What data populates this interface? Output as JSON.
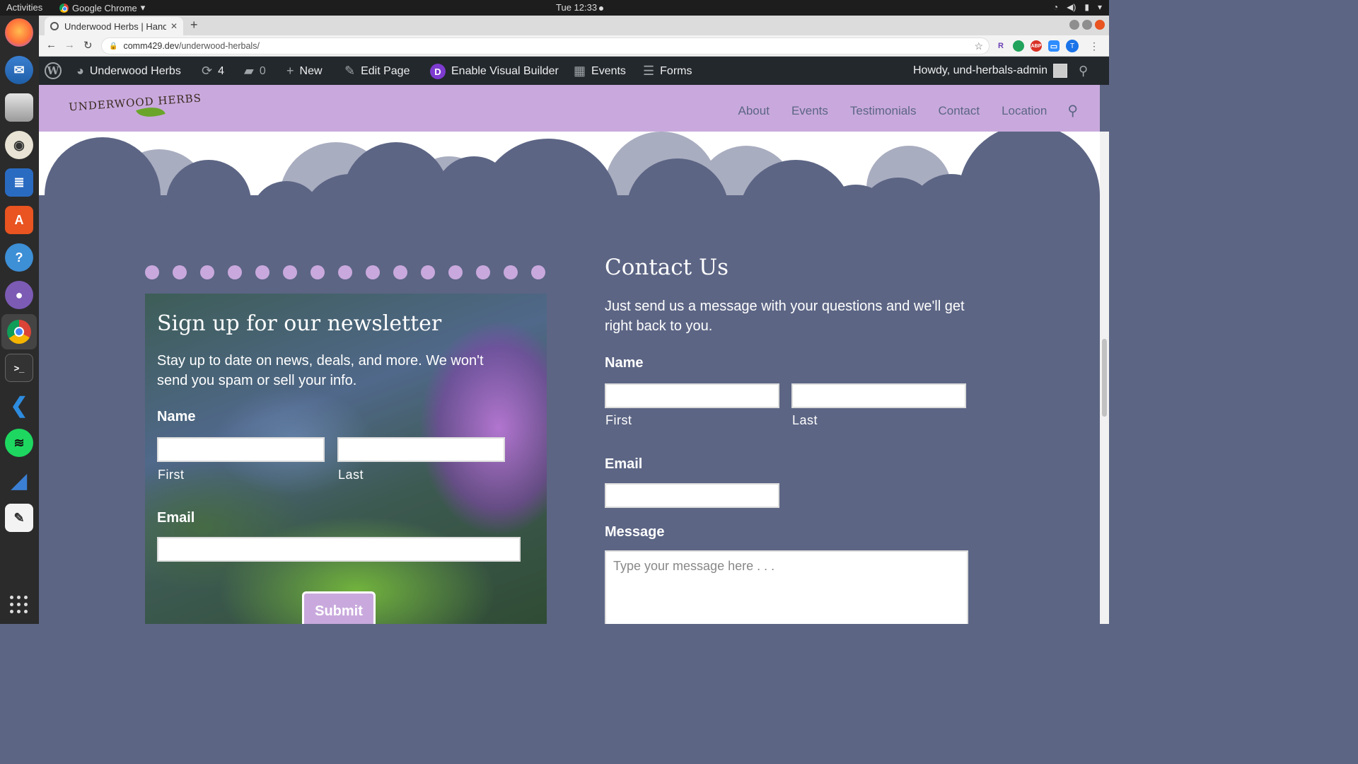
{
  "os": {
    "activities": "Activities",
    "app_menu": "Google Chrome",
    "clock": "Tue 12:33"
  },
  "browser": {
    "tab_title": "Underwood Herbs | Handmade",
    "url_domain": "comm429.dev",
    "url_path": "/underwood-herbals/",
    "profile_initial": "T"
  },
  "wp_admin": {
    "site_name": "Underwood Herbs",
    "updates_count": "4",
    "comments_count": "0",
    "new_label": "New",
    "edit_page_label": "Edit Page",
    "visual_builder_label": "Enable Visual Builder",
    "events_label": "Events",
    "forms_label": "Forms",
    "howdy": "Howdy, und-herbals-admin"
  },
  "site": {
    "logo_text": "UNDERWOOD HERBS",
    "nav": [
      "About",
      "Events",
      "Testimonials",
      "Contact",
      "Location"
    ]
  },
  "newsletter": {
    "title": "Sign up for our newsletter",
    "description": "Stay up to date on news, deals, and more. We won't send you spam or sell your info.",
    "name_label": "Name",
    "first_label": "First",
    "last_label": "Last",
    "email_label": "Email",
    "submit_label": "Submit"
  },
  "contact": {
    "title": "Contact Us",
    "description": "Just send us a message with your questions and we'll get right back to you.",
    "name_label": "Name",
    "first_label": "First",
    "last_label": "Last",
    "email_label": "Email",
    "message_label": "Message",
    "message_placeholder": "Type your message here . . ."
  },
  "colors": {
    "page_bg": "#5c6584",
    "header_bg": "#c9a9dd",
    "admin_bar_bg": "#23282d",
    "accent_purple": "#c9a9dd"
  }
}
